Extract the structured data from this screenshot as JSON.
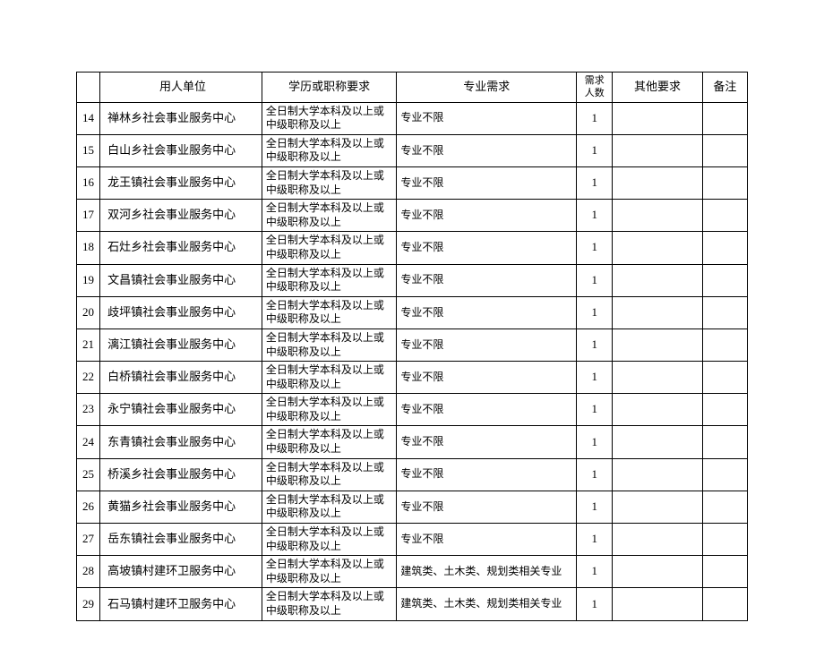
{
  "headers": {
    "index": "",
    "employer": "用人单位",
    "education": "学历或职称要求",
    "major": "专业需求",
    "number": "需求人数",
    "other": "其他要求",
    "note": "备注"
  },
  "rows": [
    {
      "idx": "14",
      "employer": "禅林乡社会事业服务中心",
      "education": "全日制大学本科及以上或中级职称及以上",
      "major": "专业不限",
      "num": "1",
      "other": "",
      "note": ""
    },
    {
      "idx": "15",
      "employer": "白山乡社会事业服务中心",
      "education": "全日制大学本科及以上或中级职称及以上",
      "major": "专业不限",
      "num": "1",
      "other": "",
      "note": ""
    },
    {
      "idx": "16",
      "employer": "龙王镇社会事业服务中心",
      "education": "全日制大学本科及以上或中级职称及以上",
      "major": "专业不限",
      "num": "1",
      "other": "",
      "note": ""
    },
    {
      "idx": "17",
      "employer": "双河乡社会事业服务中心",
      "education": "全日制大学本科及以上或中级职称及以上",
      "major": "专业不限",
      "num": "1",
      "other": "",
      "note": ""
    },
    {
      "idx": "18",
      "employer": "石灶乡社会事业服务中心",
      "education": "全日制大学本科及以上或中级职称及以上",
      "major": "专业不限",
      "num": "1",
      "other": "",
      "note": ""
    },
    {
      "idx": "19",
      "employer": "文昌镇社会事业服务中心",
      "education": "全日制大学本科及以上或中级职称及以上",
      "major": "专业不限",
      "num": "1",
      "other": "",
      "note": ""
    },
    {
      "idx": "20",
      "employer": "歧坪镇社会事业服务中心",
      "education": "全日制大学本科及以上或中级职称及以上",
      "major": "专业不限",
      "num": "1",
      "other": "",
      "note": ""
    },
    {
      "idx": "21",
      "employer": "漓江镇社会事业服务中心",
      "education": "全日制大学本科及以上或中级职称及以上",
      "major": "专业不限",
      "num": "1",
      "other": "",
      "note": ""
    },
    {
      "idx": "22",
      "employer": "白桥镇社会事业服务中心",
      "education": "全日制大学本科及以上或中级职称及以上",
      "major": "专业不限",
      "num": "1",
      "other": "",
      "note": ""
    },
    {
      "idx": "23",
      "employer": "永宁镇社会事业服务中心",
      "education": "全日制大学本科及以上或中级职称及以上",
      "major": "专业不限",
      "num": "1",
      "other": "",
      "note": ""
    },
    {
      "idx": "24",
      "employer": "东青镇社会事业服务中心",
      "education": "全日制大学本科及以上或中级职称及以上",
      "major": "专业不限",
      "num": "1",
      "other": "",
      "note": ""
    },
    {
      "idx": "25",
      "employer": "桥溪乡社会事业服务中心",
      "education": "全日制大学本科及以上或中级职称及以上",
      "major": "专业不限",
      "num": "1",
      "other": "",
      "note": ""
    },
    {
      "idx": "26",
      "employer": "黄猫乡社会事业服务中心",
      "education": "全日制大学本科及以上或中级职称及以上",
      "major": "专业不限",
      "num": "1",
      "other": "",
      "note": ""
    },
    {
      "idx": "27",
      "employer": "岳东镇社会事业服务中心",
      "education": "全日制大学本科及以上或中级职称及以上",
      "major": "专业不限",
      "num": "1",
      "other": "",
      "note": ""
    },
    {
      "idx": "28",
      "employer": "高坡镇村建环卫服务中心",
      "education": "全日制大学本科及以上或中级职称及以上",
      "major": "建筑类、土木类、规划类相关专业",
      "num": "1",
      "other": "",
      "note": ""
    },
    {
      "idx": "29",
      "employer": "石马镇村建环卫服务中心",
      "education": "全日制大学本科及以上或中级职称及以上",
      "major": "建筑类、土木类、规划类相关专业",
      "num": "1",
      "other": "",
      "note": ""
    }
  ]
}
